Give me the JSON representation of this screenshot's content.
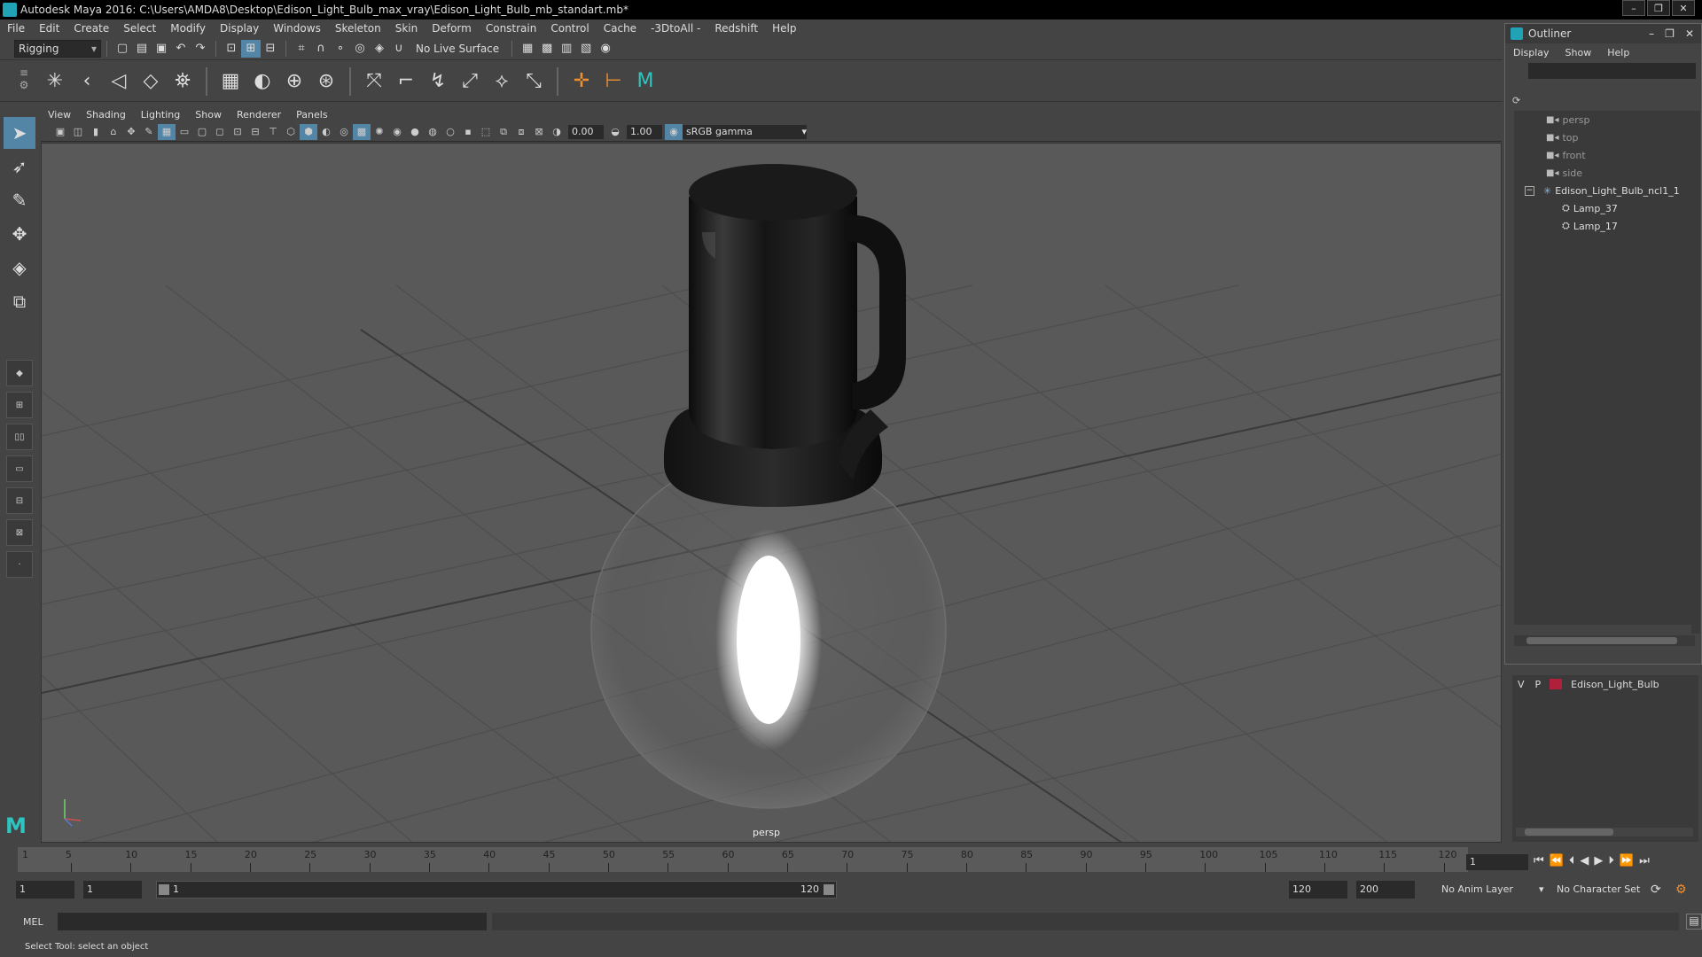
{
  "window": {
    "title": "Autodesk Maya 2016: C:\\Users\\AMDA8\\Desktop\\Edison_Light_Bulb_max_vray\\Edison_Light_Bulb_mb_standart.mb*",
    "minimize": "–",
    "maximize": "❐",
    "close": "✕"
  },
  "menubar": [
    "File",
    "Edit",
    "Create",
    "Select",
    "Modify",
    "Display",
    "Windows",
    "Skeleton",
    "Skin",
    "Deform",
    "Constrain",
    "Control",
    "Cache",
    "-3DtoAll -",
    "Redshift",
    "Help"
  ],
  "statusline": {
    "mode": "Rigging",
    "live_surface": "No Live Surface"
  },
  "panel": {
    "menus": [
      "View",
      "Shading",
      "Lighting",
      "Show",
      "Renderer",
      "Panels"
    ],
    "exposure": "0.00",
    "gamma_value": "1.00",
    "color_space": "sRGB gamma",
    "camera_label": "persp"
  },
  "outliner": {
    "title": "Outliner",
    "menus": [
      "Display",
      "Show",
      "Help"
    ],
    "items": [
      {
        "label": "persp",
        "type": "camera"
      },
      {
        "label": "top",
        "type": "camera"
      },
      {
        "label": "front",
        "type": "camera"
      },
      {
        "label": "side",
        "type": "camera"
      },
      {
        "label": "Edison_Light_Bulb_ncl1_1",
        "type": "group"
      },
      {
        "label": "Lamp_37",
        "type": "mesh"
      },
      {
        "label": "Lamp_17",
        "type": "mesh"
      }
    ]
  },
  "layers": {
    "visible_flag": "V",
    "playback_flag": "P",
    "layer_name": "Edison_Light_Bulb",
    "layer_color": "#b0203a"
  },
  "timeline": {
    "ticks": [
      5,
      10,
      15,
      20,
      25,
      30,
      35,
      40,
      45,
      50,
      55,
      60,
      65,
      70,
      75,
      80,
      85,
      90,
      95,
      100,
      105,
      110,
      115,
      120
    ],
    "start_label": "1",
    "current_frame": "1"
  },
  "range": {
    "start": "1",
    "playback_start": "1",
    "slider_start": "1",
    "slider_end": "120",
    "playback_end": "120",
    "end": "200",
    "anim_layer": "No Anim Layer",
    "character_set": "No Character Set"
  },
  "cmdline": {
    "language": "MEL"
  },
  "helpline": {
    "text": "Select Tool: select an object"
  },
  "colors": {
    "accent": "#5285a6",
    "maya_teal": "#1fa3b5"
  }
}
